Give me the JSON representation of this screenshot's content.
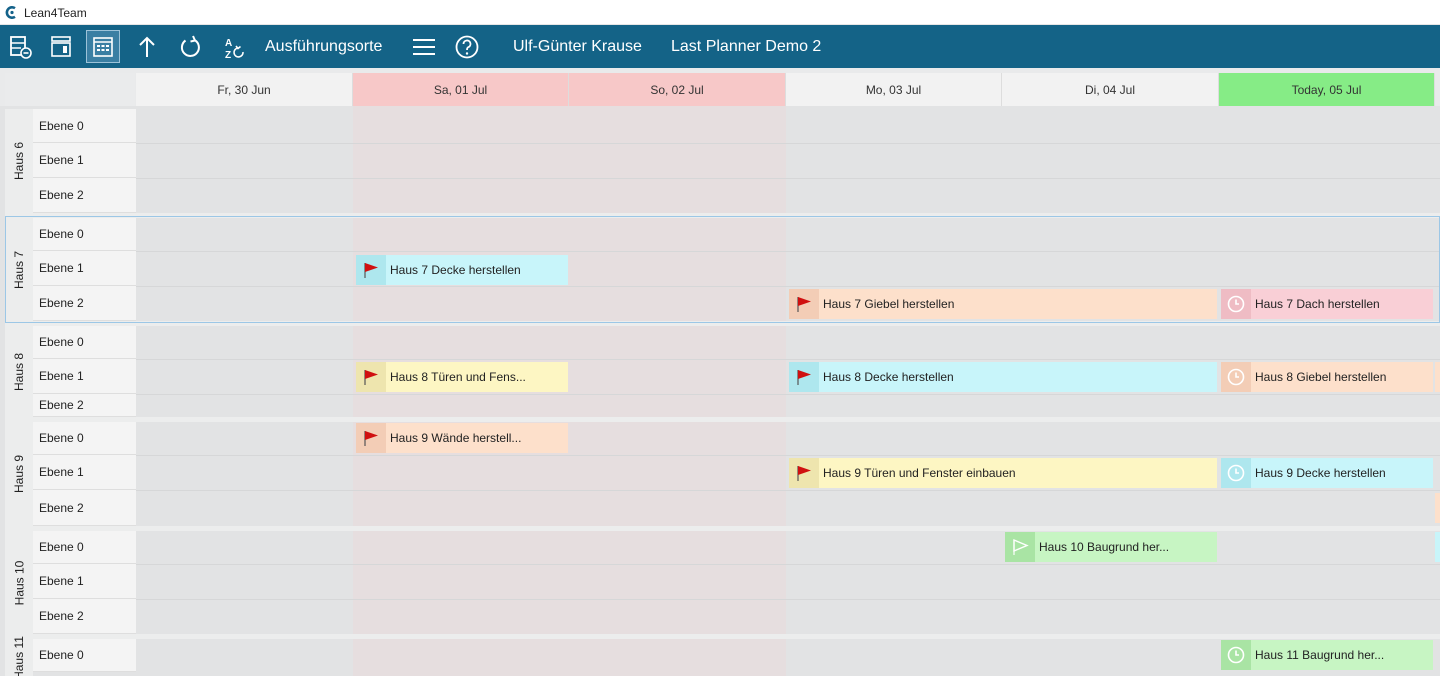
{
  "app": {
    "title": "Lean4Team"
  },
  "toolbar": {
    "locations_label": "Ausführungsorte",
    "user_name": "Ulf-Günter Krause",
    "project_name": "Last Planner Demo 2",
    "bg_color": "#146387"
  },
  "days": [
    {
      "label": "Fr,  30 Jun"
    },
    {
      "label": "Sa,  01 Jul"
    },
    {
      "label": "So,  02 Jul"
    },
    {
      "label": "Mo,  03 Jul"
    },
    {
      "label": "Di,  04 Jul"
    },
    {
      "label": "Today,  05 Jul"
    }
  ],
  "houses": [
    {
      "name": "Haus 6",
      "levels": [
        "Ebene 0",
        "Ebene 1",
        "Ebene 2"
      ]
    },
    {
      "name": "Haus 7",
      "levels": [
        "Ebene 0",
        "Ebene 1",
        "Ebene 2"
      ]
    },
    {
      "name": "Haus 8",
      "levels": [
        "Ebene 0",
        "Ebene 1",
        "Ebene 2"
      ]
    },
    {
      "name": "Haus 9",
      "levels": [
        "Ebene 0",
        "Ebene 1",
        "Ebene 2"
      ]
    },
    {
      "name": "Haus 10",
      "levels": [
        "Ebene 0",
        "Ebene 1",
        "Ebene 2"
      ]
    },
    {
      "name": "Haus 11",
      "levels": [
        "Ebene 0"
      ]
    }
  ],
  "tasks": [
    {
      "label": "Haus 7 Decke herstellen",
      "color": "blue",
      "icon": "red-flag-icon"
    },
    {
      "label": "Haus 7 Giebel herstellen",
      "color": "orange",
      "icon": "red-flag-icon"
    },
    {
      "label": "Haus 7 Dach herstellen",
      "color": "pink",
      "icon": "clock-icon"
    },
    {
      "label": "Haus 8 Türen und Fens...",
      "color": "yellow",
      "icon": "red-flag-icon"
    },
    {
      "label": "Haus 8 Decke herstellen",
      "color": "blue",
      "icon": "red-flag-icon"
    },
    {
      "label": "Haus 8 Giebel herstellen",
      "color": "orange",
      "icon": "clock-icon"
    },
    {
      "label": "Haus 9 Wände herstell...",
      "color": "orange",
      "icon": "red-flag-icon"
    },
    {
      "label": "Haus 9 Türen und Fenster einbauen",
      "color": "yellow",
      "icon": "red-flag-icon"
    },
    {
      "label": "Haus 9 Decke herstellen",
      "color": "blue",
      "icon": "clock-icon"
    },
    {
      "label": "Haus 10 Baugrund her...",
      "color": "green",
      "icon": "white-flag-icon"
    },
    {
      "label": "Haus 11 Baugrund her...",
      "color": "green",
      "icon": "clock-icon"
    }
  ]
}
